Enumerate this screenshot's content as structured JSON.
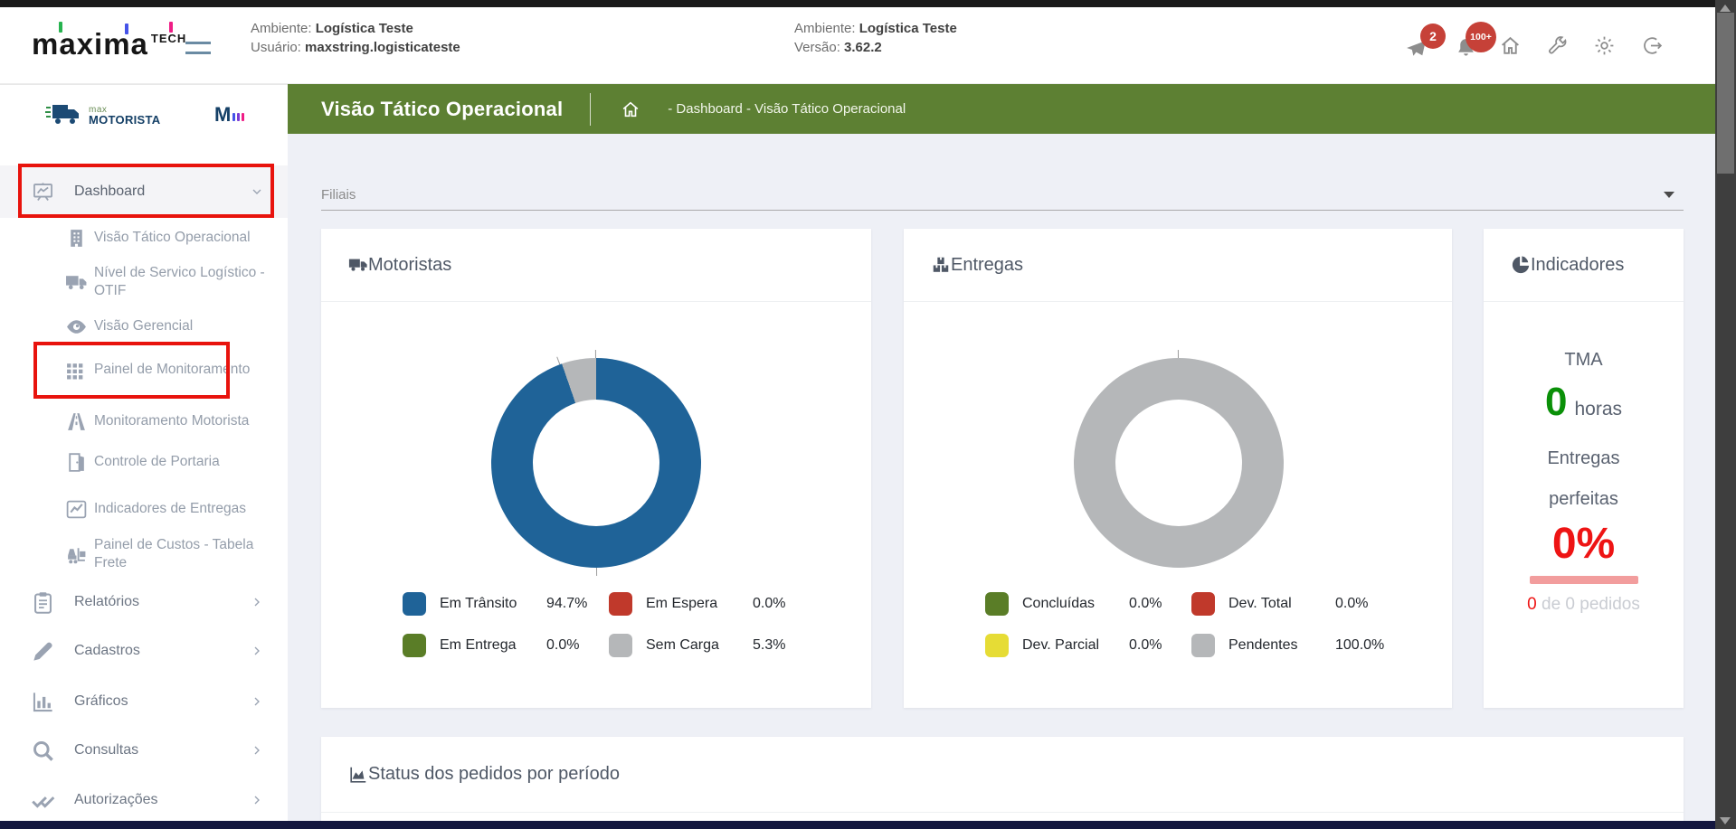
{
  "header": {
    "logo": {
      "brand": "maxima",
      "suffix": "TECH"
    },
    "info_left": {
      "ambiente_label": "Ambiente:",
      "ambiente_value": "Logística Teste",
      "usuario_label": "Usuário:",
      "usuario_value": "maxstring.logisticateste"
    },
    "info_right": {
      "ambiente_label": "Ambiente:",
      "ambiente_value": "Logística Teste",
      "versao_label": "Versão:",
      "versao_value": "3.62.2"
    },
    "badges": {
      "announcements": "2",
      "notifications": "100+"
    }
  },
  "titlebar": {
    "title": "Visão Tático Operacional",
    "breadcrumb": "- Dashboard - Visão Tático Operacional"
  },
  "sidebar": {
    "brand_small": "max",
    "brand_big": "MOTORISTA",
    "brand_mini": "M",
    "items": [
      {
        "label": "Dashboard",
        "active": true
      },
      {
        "label": "Visão Tático Operacional"
      },
      {
        "label": "Nível de Servico Logístico - OTIF"
      },
      {
        "label": "Visão Gerencial"
      },
      {
        "label": "Painel de Monitoramento"
      },
      {
        "label": "Monitoramento Motorista"
      },
      {
        "label": "Controle de Portaria"
      },
      {
        "label": "Indicadores de Entregas"
      },
      {
        "label": "Painel de Custos - Tabela Frete"
      },
      {
        "label": "Relatórios"
      },
      {
        "label": "Cadastros"
      },
      {
        "label": "Gráficos"
      },
      {
        "label": "Consultas"
      },
      {
        "label": "Autorizações"
      }
    ]
  },
  "filters": {
    "filiais_label": "Filiais"
  },
  "cards": {
    "motoristas": {
      "title": "Motoristas",
      "legend": [
        {
          "label": "Em Trânsito",
          "value": "94.7%",
          "color": "#1f6398"
        },
        {
          "label": "Em Espera",
          "value": "0.0%",
          "color": "#c0392b"
        },
        {
          "label": "Em Entrega",
          "value": "0.0%",
          "color": "#5a7d27"
        },
        {
          "label": "Sem Carga",
          "value": "5.3%",
          "color": "#b5b7b9"
        }
      ]
    },
    "entregas": {
      "title": "Entregas",
      "legend": [
        {
          "label": "Concluídas",
          "value": "0.0%",
          "color": "#5a7d27"
        },
        {
          "label": "Dev. Total",
          "value": "0.0%",
          "color": "#c0392b"
        },
        {
          "label": "Dev. Parcial",
          "value": "0.0%",
          "color": "#e6dc35"
        },
        {
          "label": "Pendentes",
          "value": "100.0%",
          "color": "#b5b7b9"
        }
      ]
    },
    "indicadores": {
      "title": "Indicadores",
      "tma_label": "TMA",
      "tma_value": "0",
      "tma_unit": "horas",
      "line1": "Entregas",
      "line2": "perfeitas",
      "percent": "0%",
      "orders_value": "0",
      "orders_rest": " de 0 pedidos"
    },
    "status": {
      "title": "Status dos pedidos por período"
    }
  },
  "colors": {
    "titlebar_green": "#5d8033",
    "donut_blue": "#1f6398",
    "donut_gray": "#b5b7b9",
    "legend_red": "#c0392b",
    "legend_green": "#5a7d27",
    "legend_yellow": "#e6dc35",
    "kpi_green": "#0a9008",
    "kpi_red": "#ee1414",
    "annotation_red": "#e8130d",
    "bottombar_navy": "#14173f"
  },
  "chart_data": [
    {
      "type": "pie",
      "style": "donut",
      "title": "Motoristas",
      "labels": [
        "Em Trânsito",
        "Em Espera",
        "Em Entrega",
        "Sem Carga"
      ],
      "values": [
        94.7,
        0.0,
        0.0,
        5.3
      ],
      "colors": [
        "#1f6398",
        "#c0392b",
        "#5a7d27",
        "#b5b7b9"
      ],
      "legend_position": "bottom"
    },
    {
      "type": "pie",
      "style": "donut",
      "title": "Entregas",
      "labels": [
        "Concluídas",
        "Dev. Total",
        "Dev. Parcial",
        "Pendentes"
      ],
      "values": [
        0.0,
        0.0,
        0.0,
        100.0
      ],
      "colors": [
        "#5a7d27",
        "#c0392b",
        "#e6dc35",
        "#b5b7b9"
      ],
      "legend_position": "bottom"
    }
  ]
}
